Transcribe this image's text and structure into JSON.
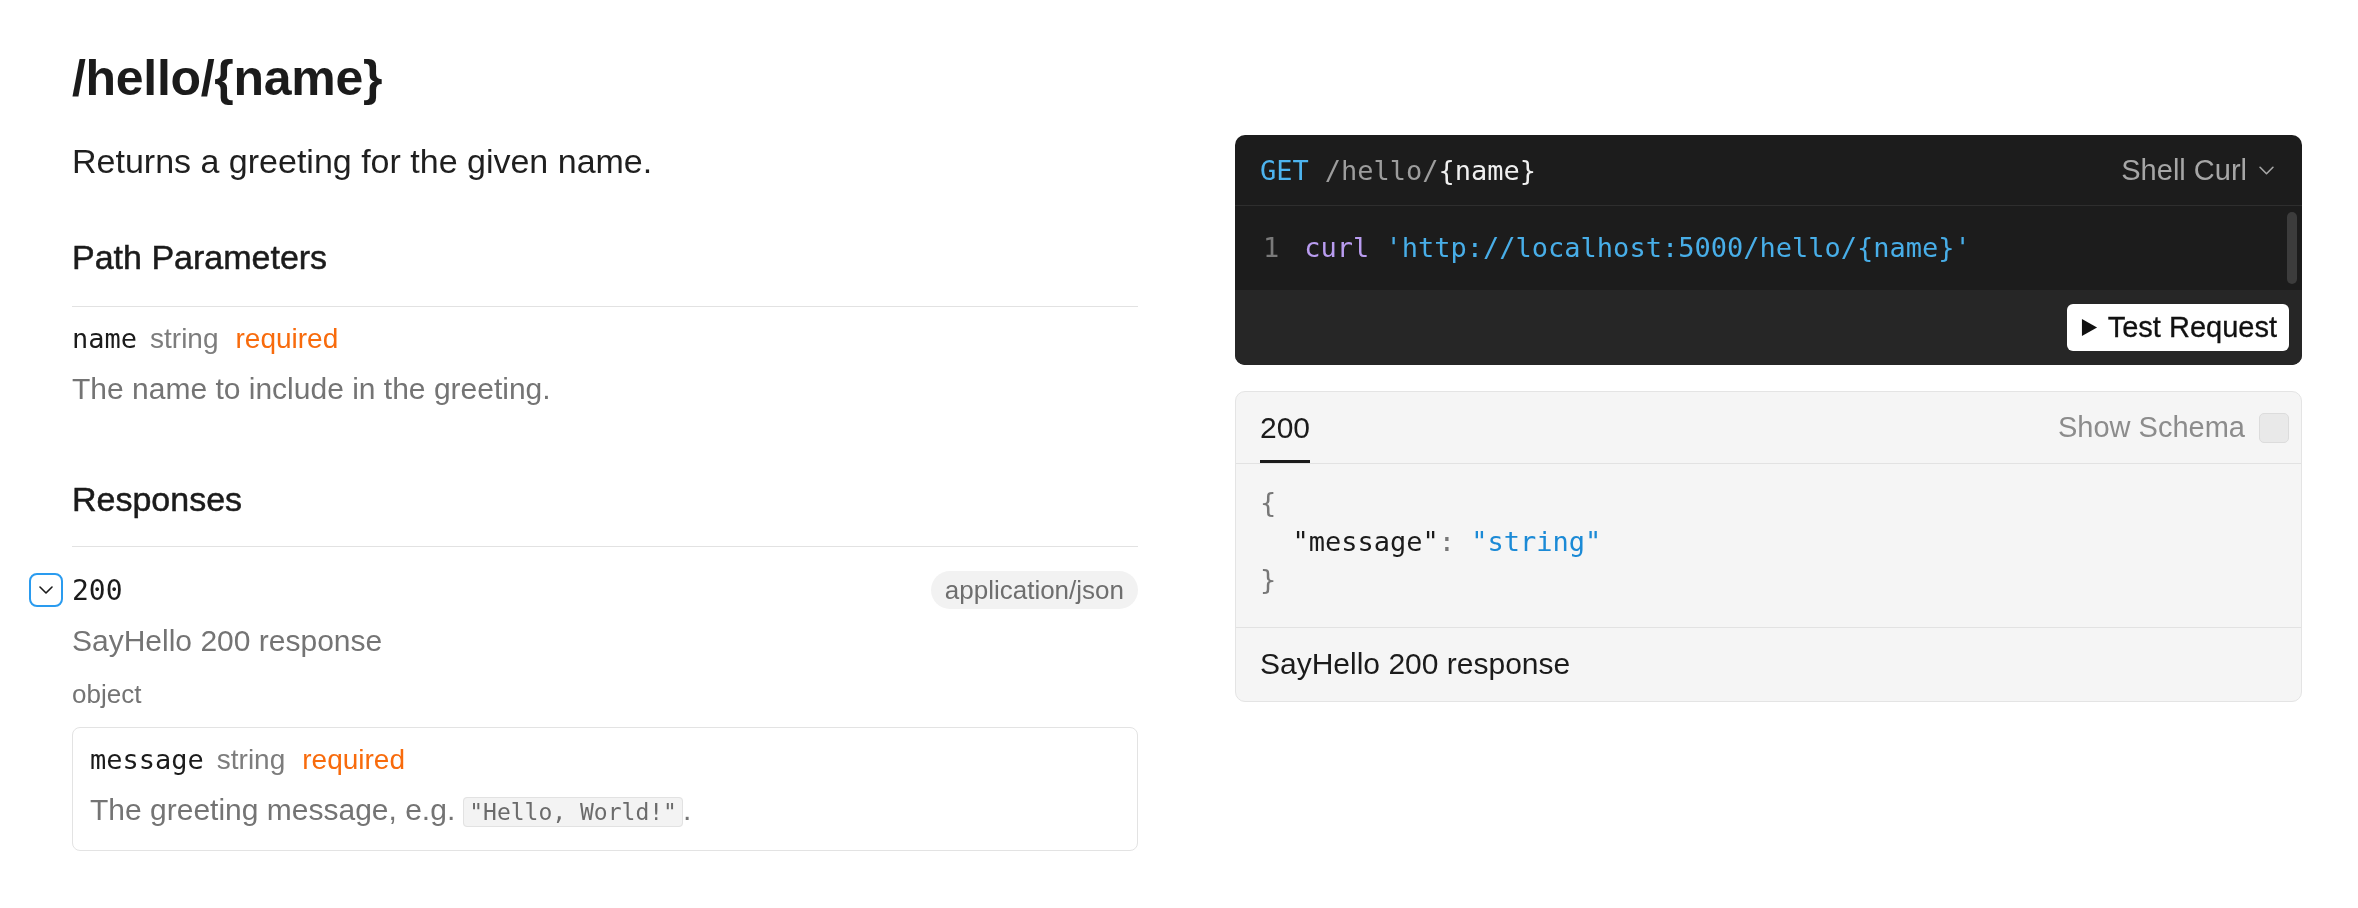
{
  "endpoint": {
    "title": "/hello/{name}",
    "description": "Returns a greeting for the given name."
  },
  "path_parameters": {
    "heading": "Path Parameters",
    "params": [
      {
        "name": "name",
        "type": "string",
        "required": true,
        "required_label": "required",
        "description": "The name to include in the greeting."
      }
    ]
  },
  "responses": {
    "heading": "Responses",
    "items": [
      {
        "code": "200",
        "expanded": true,
        "media_type": "application/json",
        "description": "SayHello 200 response",
        "schema_type": "object",
        "properties": [
          {
            "name": "message",
            "type": "string",
            "required": true,
            "required_label": "required",
            "description": [
              {
                "kind": "text",
                "text": "The greeting message, e.g."
              },
              {
                "kind": "code",
                "text": "\"Hello, World!\""
              },
              {
                "kind": "text",
                "text": "."
              }
            ]
          }
        ]
      }
    ]
  },
  "code_sample": {
    "method": "GET",
    "path": [
      {
        "kind": "static",
        "text": "/hello/"
      },
      {
        "kind": "param",
        "text": "{name}"
      }
    ],
    "language": "Shell Curl",
    "lines": [
      {
        "number": "1",
        "tokens": [
          {
            "kind": "command",
            "text": "curl"
          },
          {
            "kind": "string",
            "text": "'http://localhost:5000/hello/{name}'"
          }
        ]
      }
    ],
    "button": "Test Request"
  },
  "response_panel": {
    "tabs": [
      {
        "label": "200",
        "selected": true
      }
    ],
    "show_schema": {
      "label": "Show Schema",
      "checked": false
    },
    "example": {
      "open": "{",
      "entries": [
        {
          "key": "\"message\"",
          "colon": ":",
          "value": "\"string\""
        }
      ],
      "close": "}"
    },
    "description": "SayHello 200 response"
  }
}
